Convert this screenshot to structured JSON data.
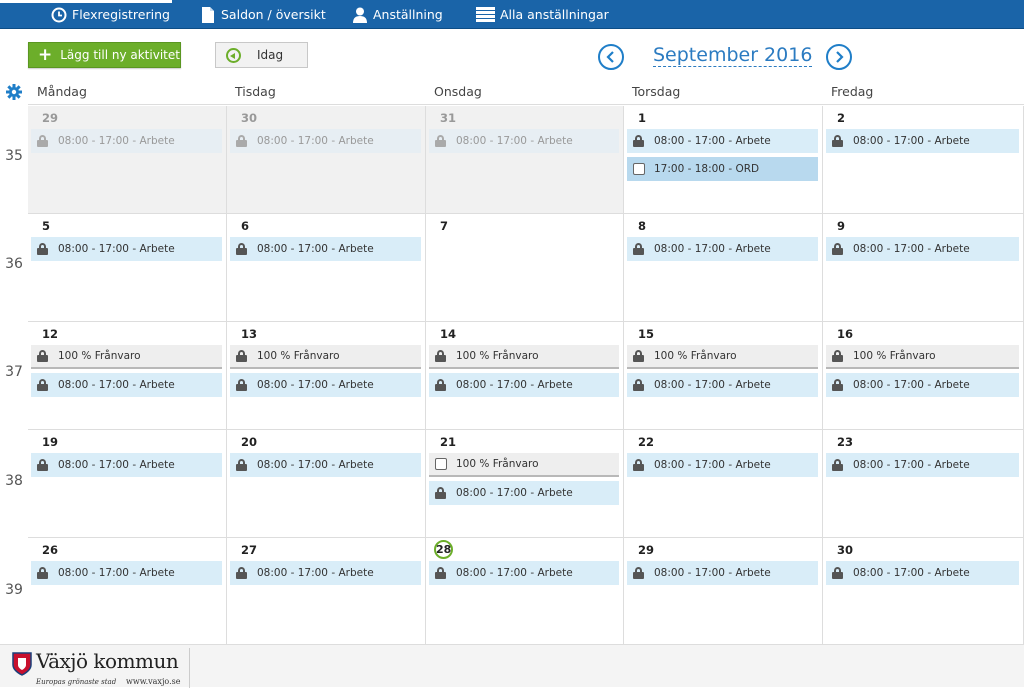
{
  "nav": {
    "items": [
      {
        "label": "Flexregistrering",
        "icon": "clock-icon"
      },
      {
        "label": "Saldon / översikt",
        "icon": "document-icon"
      },
      {
        "label": "Anställning",
        "icon": "user-icon"
      },
      {
        "label": "Alla anställningar",
        "icon": "list-icon"
      }
    ]
  },
  "toolbar": {
    "add_label": "Lägg till ny aktivitet",
    "today_label": "Idag",
    "month_title": "September 2016"
  },
  "days": [
    "Måndag",
    "Tisdag",
    "Onsdag",
    "Torsdag",
    "Fredag"
  ],
  "weeks": [
    {
      "num": "35",
      "cells": [
        {
          "day": "29",
          "past": true,
          "events": [
            {
              "type": "work",
              "label": "08:00 - 17:00 - Arbete"
            }
          ]
        },
        {
          "day": "30",
          "past": true,
          "events": [
            {
              "type": "work",
              "label": "08:00 - 17:00 - Arbete"
            }
          ]
        },
        {
          "day": "31",
          "past": true,
          "events": [
            {
              "type": "work",
              "label": "08:00 - 17:00 - Arbete"
            }
          ]
        },
        {
          "day": "1",
          "events": [
            {
              "type": "work",
              "label": "08:00 - 17:00 - Arbete"
            },
            {
              "type": "ord",
              "label": "17:00 - 18:00 - ORD"
            }
          ]
        },
        {
          "day": "2",
          "events": [
            {
              "type": "work",
              "label": "08:00 - 17:00 - Arbete"
            }
          ]
        }
      ]
    },
    {
      "num": "36",
      "cells": [
        {
          "day": "5",
          "events": [
            {
              "type": "work",
              "label": "08:00 - 17:00 - Arbete"
            }
          ]
        },
        {
          "day": "6",
          "events": [
            {
              "type": "work",
              "label": "08:00 - 17:00 - Arbete"
            }
          ]
        },
        {
          "day": "7",
          "events": []
        },
        {
          "day": "8",
          "events": [
            {
              "type": "work",
              "label": "08:00 - 17:00 - Arbete"
            }
          ]
        },
        {
          "day": "9",
          "events": [
            {
              "type": "work",
              "label": "08:00 - 17:00 - Arbete"
            }
          ]
        }
      ]
    },
    {
      "num": "37",
      "cells": [
        {
          "day": "12",
          "events": [
            {
              "type": "absence",
              "label": "100 %  Frånvaro"
            },
            {
              "type": "work",
              "label": "08:00 - 17:00 - Arbete"
            }
          ]
        },
        {
          "day": "13",
          "events": [
            {
              "type": "absence",
              "label": "100 %  Frånvaro"
            },
            {
              "type": "work",
              "label": "08:00 - 17:00 - Arbete"
            }
          ]
        },
        {
          "day": "14",
          "events": [
            {
              "type": "absence",
              "label": "100 %  Frånvaro"
            },
            {
              "type": "work",
              "label": "08:00 - 17:00 - Arbete"
            }
          ]
        },
        {
          "day": "15",
          "events": [
            {
              "type": "absence",
              "label": "100 %  Frånvaro"
            },
            {
              "type": "work",
              "label": "08:00 - 17:00 - Arbete"
            }
          ]
        },
        {
          "day": "16",
          "events": [
            {
              "type": "absence",
              "label": "100 %  Frånvaro"
            },
            {
              "type": "work",
              "label": "08:00 - 17:00 - Arbete"
            }
          ]
        }
      ]
    },
    {
      "num": "38",
      "cells": [
        {
          "day": "19",
          "events": [
            {
              "type": "work",
              "label": "08:00 - 17:00 - Arbete"
            }
          ]
        },
        {
          "day": "20",
          "events": [
            {
              "type": "work",
              "label": "08:00 - 17:00 - Arbete"
            }
          ]
        },
        {
          "day": "21",
          "events": [
            {
              "type": "absence-open",
              "label": "100 %  Frånvaro"
            },
            {
              "type": "work",
              "label": "08:00 - 17:00 - Arbete"
            }
          ]
        },
        {
          "day": "22",
          "events": [
            {
              "type": "work",
              "label": "08:00 - 17:00 - Arbete"
            }
          ]
        },
        {
          "day": "23",
          "events": [
            {
              "type": "work",
              "label": "08:00 - 17:00 - Arbete"
            }
          ]
        }
      ]
    },
    {
      "num": "39",
      "cells": [
        {
          "day": "26",
          "events": [
            {
              "type": "work",
              "label": "08:00 - 17:00 - Arbete"
            }
          ]
        },
        {
          "day": "27",
          "events": [
            {
              "type": "work",
              "label": "08:00 - 17:00 - Arbete"
            }
          ]
        },
        {
          "day": "28",
          "today": true,
          "events": [
            {
              "type": "work",
              "label": "08:00 - 17:00 - Arbete"
            }
          ]
        },
        {
          "day": "29",
          "events": [
            {
              "type": "work",
              "label": "08:00 - 17:00 - Arbete"
            }
          ]
        },
        {
          "day": "30",
          "events": [
            {
              "type": "work",
              "label": "08:00 - 17:00 - Arbete"
            }
          ]
        }
      ]
    }
  ],
  "footer": {
    "logo_text": "Växjö kommun",
    "tagline": "Europas grönaste stad",
    "url": "www.vaxjo.se"
  },
  "colors": {
    "nav_bg": "#1a64a8",
    "accent_green": "#6cae2a",
    "accent_blue": "#2b7bc1",
    "event_bg": "#d9edf8"
  }
}
